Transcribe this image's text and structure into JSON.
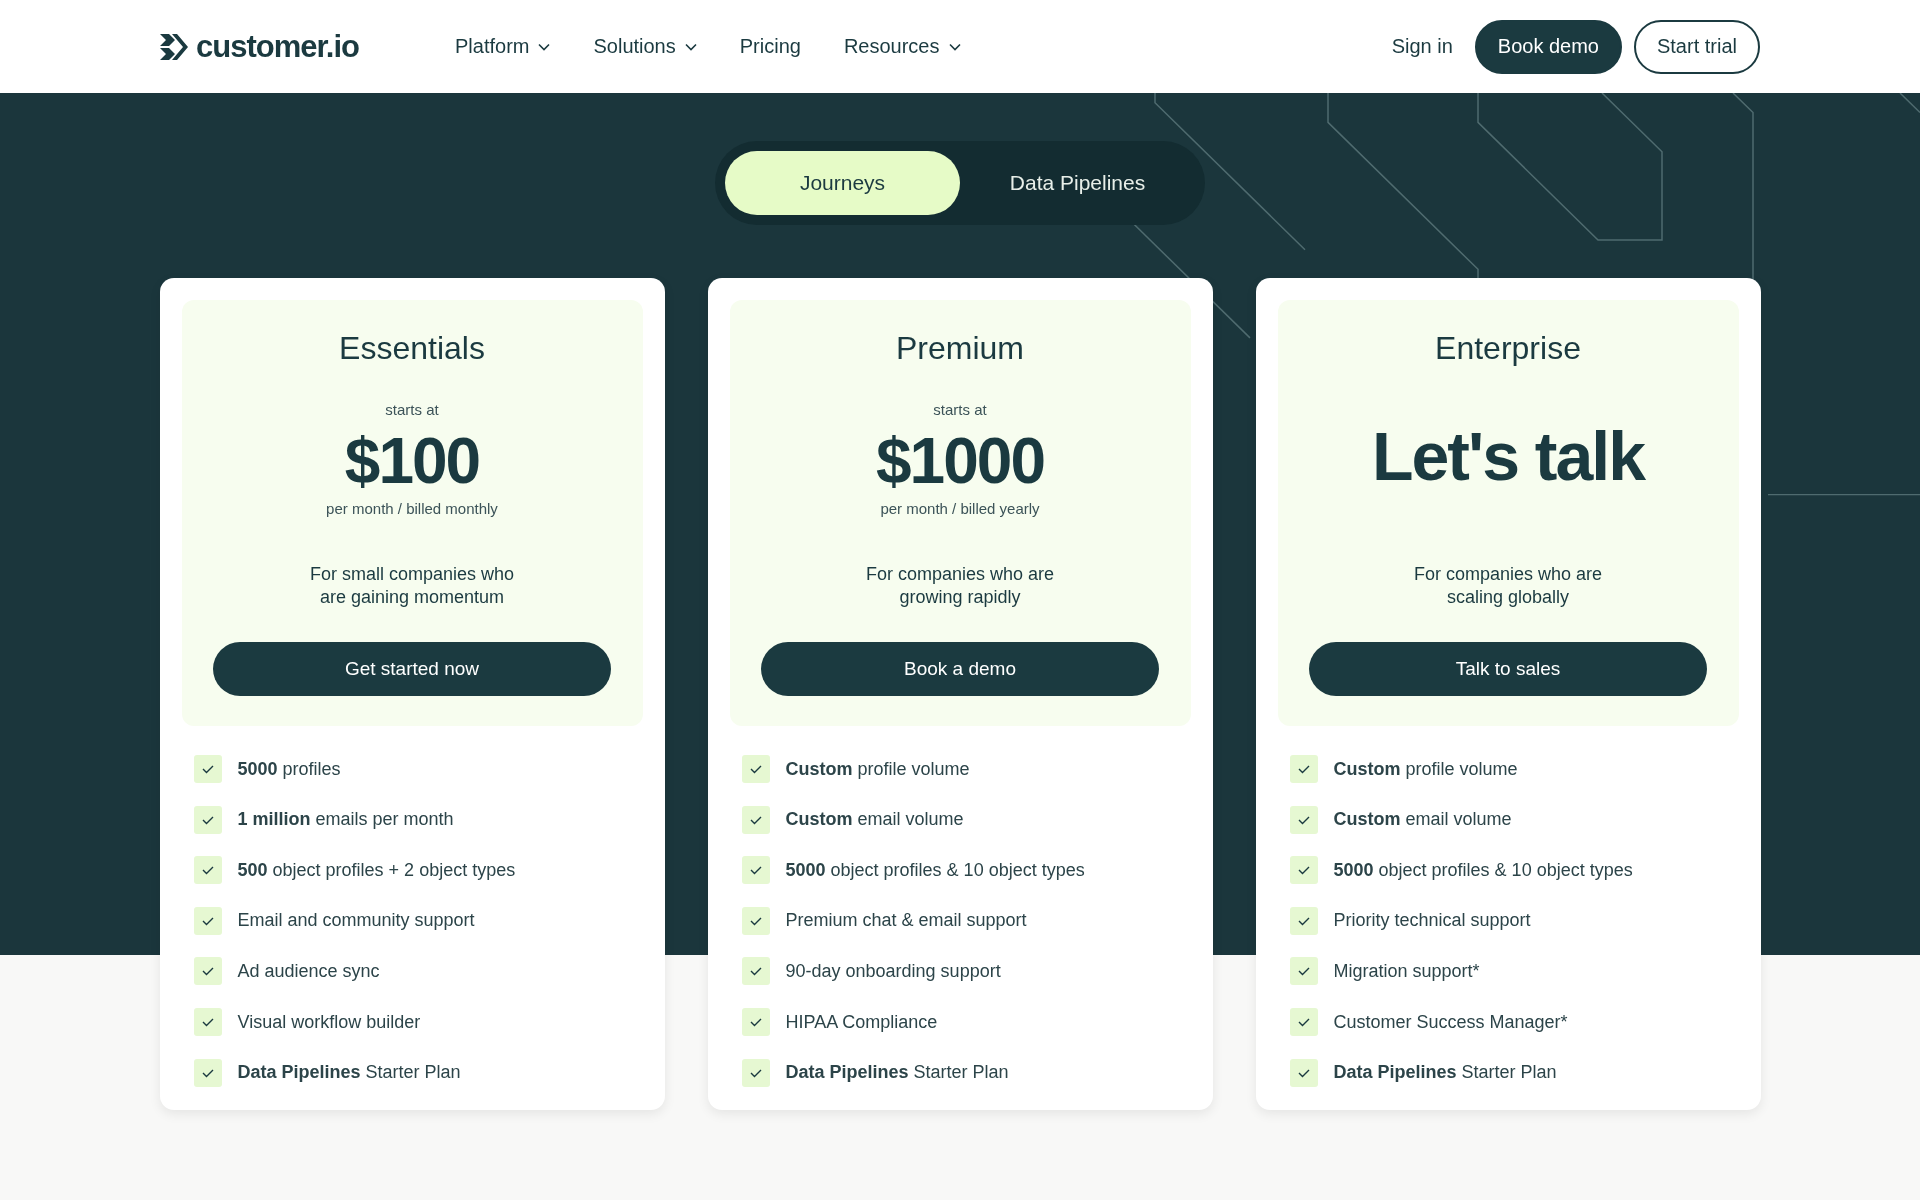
{
  "header": {
    "logo": "customer.io",
    "nav": [
      {
        "label": "Platform",
        "dropdown": true
      },
      {
        "label": "Solutions",
        "dropdown": true
      },
      {
        "label": "Pricing",
        "dropdown": false
      },
      {
        "label": "Resources",
        "dropdown": true
      }
    ],
    "sign_in": "Sign in",
    "book_demo": "Book demo",
    "start_trial": "Start trial"
  },
  "toggle": [
    {
      "label": "Journeys",
      "selected": true
    },
    {
      "label": "Data Pipelines",
      "selected": false
    }
  ],
  "plans": [
    {
      "name": "Essentials",
      "starts_at": "starts at",
      "price": "$100",
      "billing": "per month / billed monthly",
      "description": "For small companies who are gaining momentum",
      "cta": "Get started now",
      "features": [
        "**5000** profiles",
        "**1 million** emails per month",
        "**500** object profiles + 2 object types",
        "Email and community support",
        "Ad audience sync",
        "Visual workflow builder",
        "**Data Pipelines** Starter Plan"
      ]
    },
    {
      "name": "Premium",
      "starts_at": "starts at",
      "price": "$1000",
      "billing": "per month / billed yearly",
      "description": "For companies who are growing rapidly",
      "cta": "Book a demo",
      "features": [
        "**Custom** profile volume",
        "**Custom** email volume",
        "**5000** object profiles & 10 object types",
        "Premium chat & email support",
        "90-day onboarding support",
        "HIPAA Compliance",
        "**Data Pipelines** Starter Plan"
      ]
    },
    {
      "name": "Enterprise",
      "price": "Let's talk",
      "description": "For companies who are scaling globally",
      "cta": "Talk to sales",
      "features": [
        "**Custom** profile volume",
        "**Custom** email volume",
        "**5000** object profiles & 10 object types",
        "Priority technical support",
        "Migration support*",
        "Customer Success Manager*",
        "**Data Pipelines** Starter Plan"
      ]
    }
  ]
}
